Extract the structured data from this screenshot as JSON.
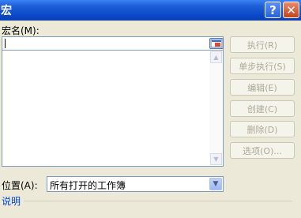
{
  "window": {
    "title": "宏",
    "help_button": "?",
    "close_button": "✕"
  },
  "macro_name": {
    "label": "宏名(M):",
    "value": ""
  },
  "buttons": {
    "run": "执行(R)",
    "step_into": "单步执行(S)",
    "edit": "编辑(E)",
    "create": "创建(C)",
    "delete": "删除(D)",
    "options": "选项(O)..."
  },
  "location": {
    "label": "位置(A):",
    "selected": "所有打开的工作簿"
  },
  "description": {
    "label": "说明"
  },
  "icons": [
    "help-icon",
    "close-icon",
    "collapse-dialog-icon",
    "scroll-up-icon",
    "scroll-down-icon",
    "dropdown-arrow-icon"
  ]
}
